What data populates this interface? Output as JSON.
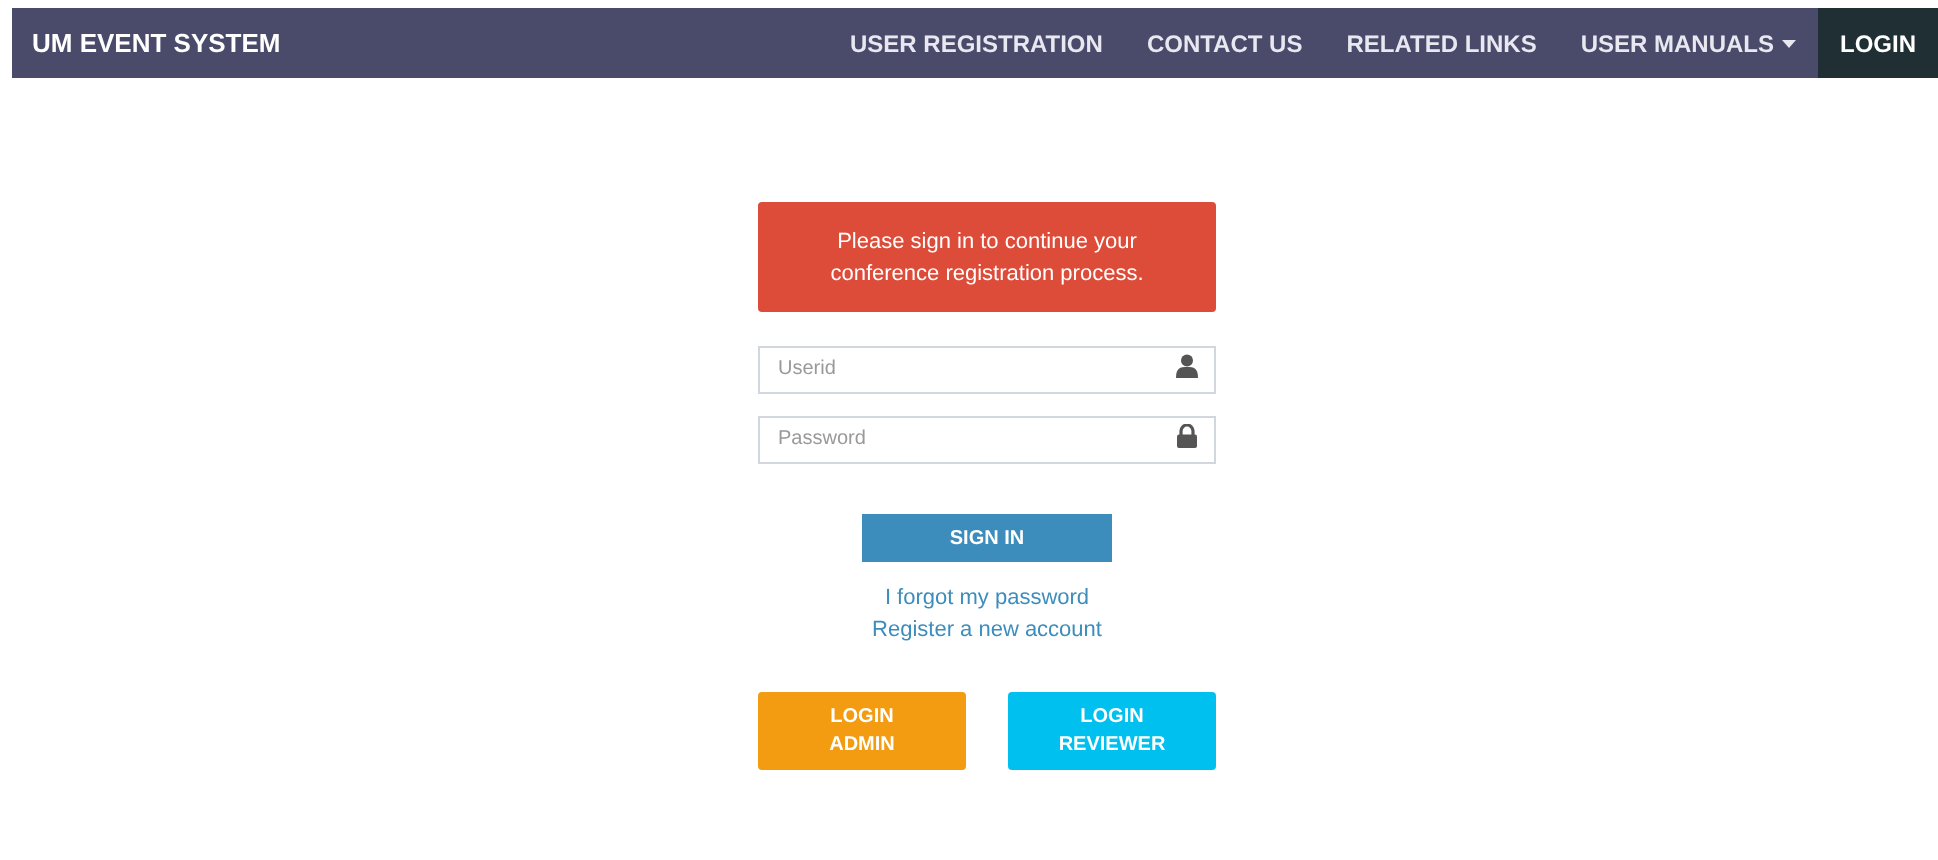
{
  "navbar": {
    "brand": "UM EVENT SYSTEM",
    "items": [
      {
        "label": "USER REGISTRATION",
        "selected": false,
        "dropdown": false
      },
      {
        "label": "CONTACT US",
        "selected": false,
        "dropdown": false
      },
      {
        "label": "RELATED LINKS",
        "selected": false,
        "dropdown": false
      },
      {
        "label": "USER MANUALS",
        "selected": false,
        "dropdown": true
      },
      {
        "label": "LOGIN",
        "selected": true,
        "dropdown": false
      }
    ]
  },
  "alert": "Please sign in to continue your conference registration process.",
  "fields": [
    {
      "placeholder": "Userid",
      "kind": "user"
    },
    {
      "placeholder": "Password",
      "kind": "lock"
    }
  ],
  "sign_in": "SIGN IN",
  "links": [
    "I forgot my password",
    "Register a new account"
  ],
  "login_buttons": [
    {
      "label": "LOGIN ADMIN",
      "color": "#f39c12"
    },
    {
      "label": "LOGIN REVIEWER",
      "color": "#00c0ef"
    }
  ]
}
